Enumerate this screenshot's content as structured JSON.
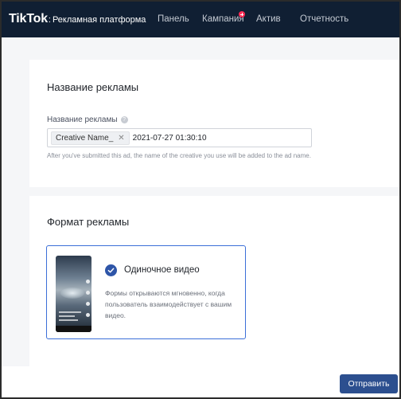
{
  "header": {
    "logo": "TikTok",
    "logo_colon": ":",
    "subtitle": "Рекламная платформа",
    "nav": [
      {
        "label": "Панель"
      },
      {
        "label": "Кампания",
        "badge": "+"
      },
      {
        "label": "Актив"
      },
      {
        "label": "Отчетность"
      }
    ]
  },
  "ad_name_section": {
    "title": "Название рекламы",
    "field_label": "Название рекламы",
    "tag": "Creative Name_",
    "value": "2021-07-27 01:30:10",
    "hint": "After you've submitted this ad, the name of the creative you use will be added to the ad name."
  },
  "format_section": {
    "title": "Формат рекламы",
    "option": {
      "title": "Одиночное видео",
      "description": "Формы открываются мгновенно, когда пользователь взаимодействует с вашим видео.",
      "selected": true
    }
  },
  "footer": {
    "submit_label": "Отправить"
  },
  "colors": {
    "topbar": "#101f33",
    "accent": "#2c4f8f",
    "badge": "#fe2c55",
    "selected_border": "#3b6fd8"
  }
}
